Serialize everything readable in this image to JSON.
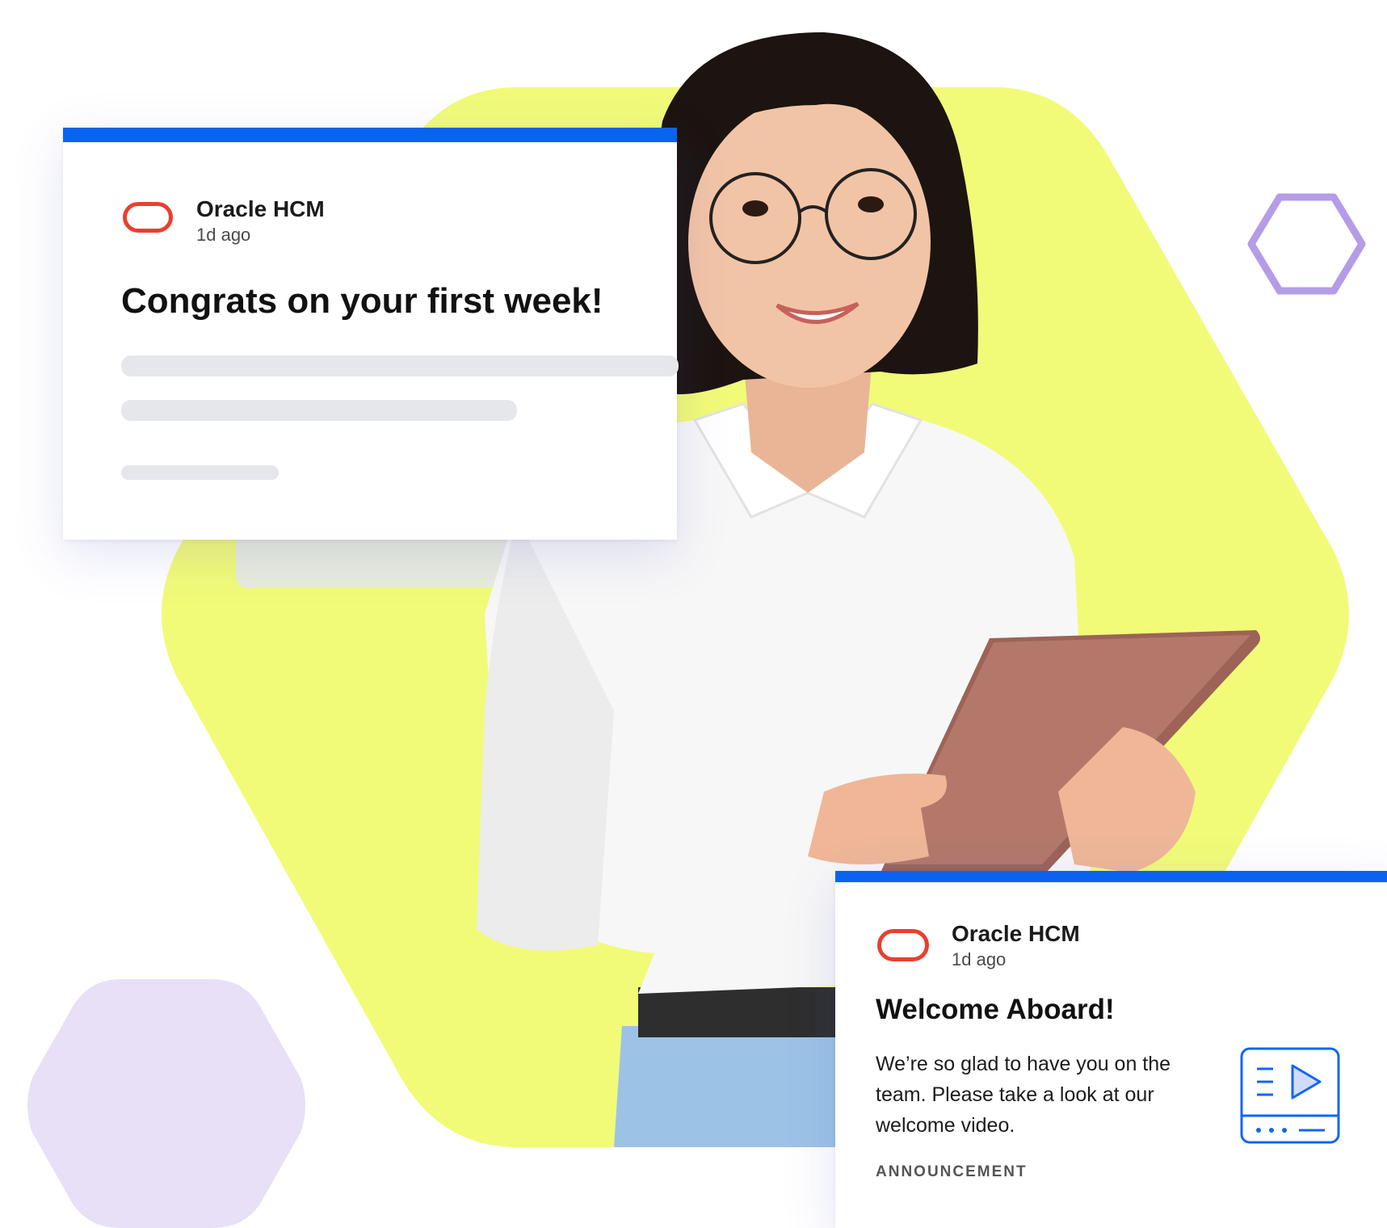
{
  "colors": {
    "accent_blue": "#0a63f0",
    "brand_red": "#e8402f",
    "hexagon_yellow": "#f1fb78",
    "hexagon_purple_outline": "#b49ce8",
    "hexagon_lavender": "#e7e0f6"
  },
  "card_congrats": {
    "sender": "Oracle HCM",
    "age": "1d ago",
    "title": "Congrats on your first week!"
  },
  "card_welcome": {
    "sender": "Oracle HCM",
    "age": "1d ago",
    "title": "Welcome Aboard!",
    "body": "We’re so glad to have you on the team. Please take a look at our welcome video.",
    "tag": "ANNOUNCEMENT",
    "video_icon": "video-play-icon"
  },
  "decor": {
    "logo_icon": "oracle-ring-icon",
    "person": "woman-holding-tablet"
  }
}
